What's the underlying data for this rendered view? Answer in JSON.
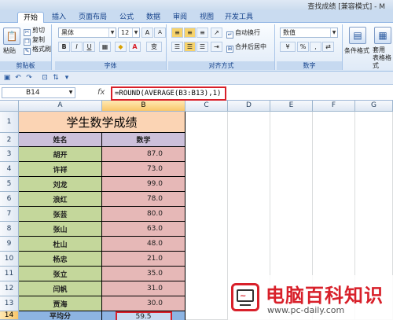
{
  "window": {
    "title": "查找成绩 [兼容模式] - M"
  },
  "ribbon": {
    "tabs": [
      "开始",
      "插入",
      "页面布局",
      "公式",
      "数据",
      "审阅",
      "视图",
      "开发工具"
    ],
    "clipboard": {
      "paste": "粘贴",
      "cut": "剪切",
      "copy": "复制",
      "format_painter": "格式刷",
      "label": "剪贴板"
    },
    "font": {
      "name": "黑体",
      "size": "12",
      "label": "字体",
      "grow": "A",
      "shrink": "A",
      "bold": "B",
      "italic": "I",
      "underline": "U",
      "color_a": "A",
      "phonetic": "变"
    },
    "alignment": {
      "wrap": "自动换行",
      "merge": "合并后居中",
      "label": "对齐方式"
    },
    "number": {
      "format": "数值",
      "percent": "%",
      "comma": ",",
      "label": "数字"
    },
    "styles": {
      "conditional": "条件格式",
      "table_format": "套用\n表格格式"
    }
  },
  "formula_bar": {
    "name_box": "B14",
    "fx": "fx",
    "formula": "=ROUND(AVERAGE(B3:B13),1)"
  },
  "sheet": {
    "columns": [
      "A",
      "B",
      "C",
      "D",
      "E",
      "F",
      "G"
    ],
    "rows": [
      "1",
      "2",
      "3",
      "4",
      "5",
      "6",
      "7",
      "8",
      "9",
      "10",
      "11",
      "12",
      "13",
      "14"
    ],
    "title": "学生数学成绩",
    "header": {
      "name": "姓名",
      "score": "数学"
    },
    "students": [
      {
        "name": "胡开",
        "score": "87.0"
      },
      {
        "name": "许祥",
        "score": "73.0"
      },
      {
        "name": "刘龙",
        "score": "99.0"
      },
      {
        "name": "浪红",
        "score": "78.0"
      },
      {
        "name": "张芸",
        "score": "80.0"
      },
      {
        "name": "张山",
        "score": "63.0"
      },
      {
        "name": "杜山",
        "score": "48.0"
      },
      {
        "name": "杨忠",
        "score": "21.0"
      },
      {
        "name": "张立",
        "score": "35.0"
      },
      {
        "name": "闫帆",
        "score": "31.0"
      },
      {
        "name": "贾海",
        "score": "30.0"
      }
    ],
    "average": {
      "label": "平均分",
      "value": "59.5"
    },
    "selected_cell": "B14"
  },
  "watermark": {
    "title": "电脑百科知识",
    "url": "www.pc-daily.com"
  },
  "colors": {
    "title_bg": "#fbd4b4",
    "header_bg": "#ccc0da",
    "name_bg": "#c4d79b",
    "score_bg": "#e6b8b7",
    "avg_bg": "#8db4e2",
    "highlight": "#d8202a"
  }
}
